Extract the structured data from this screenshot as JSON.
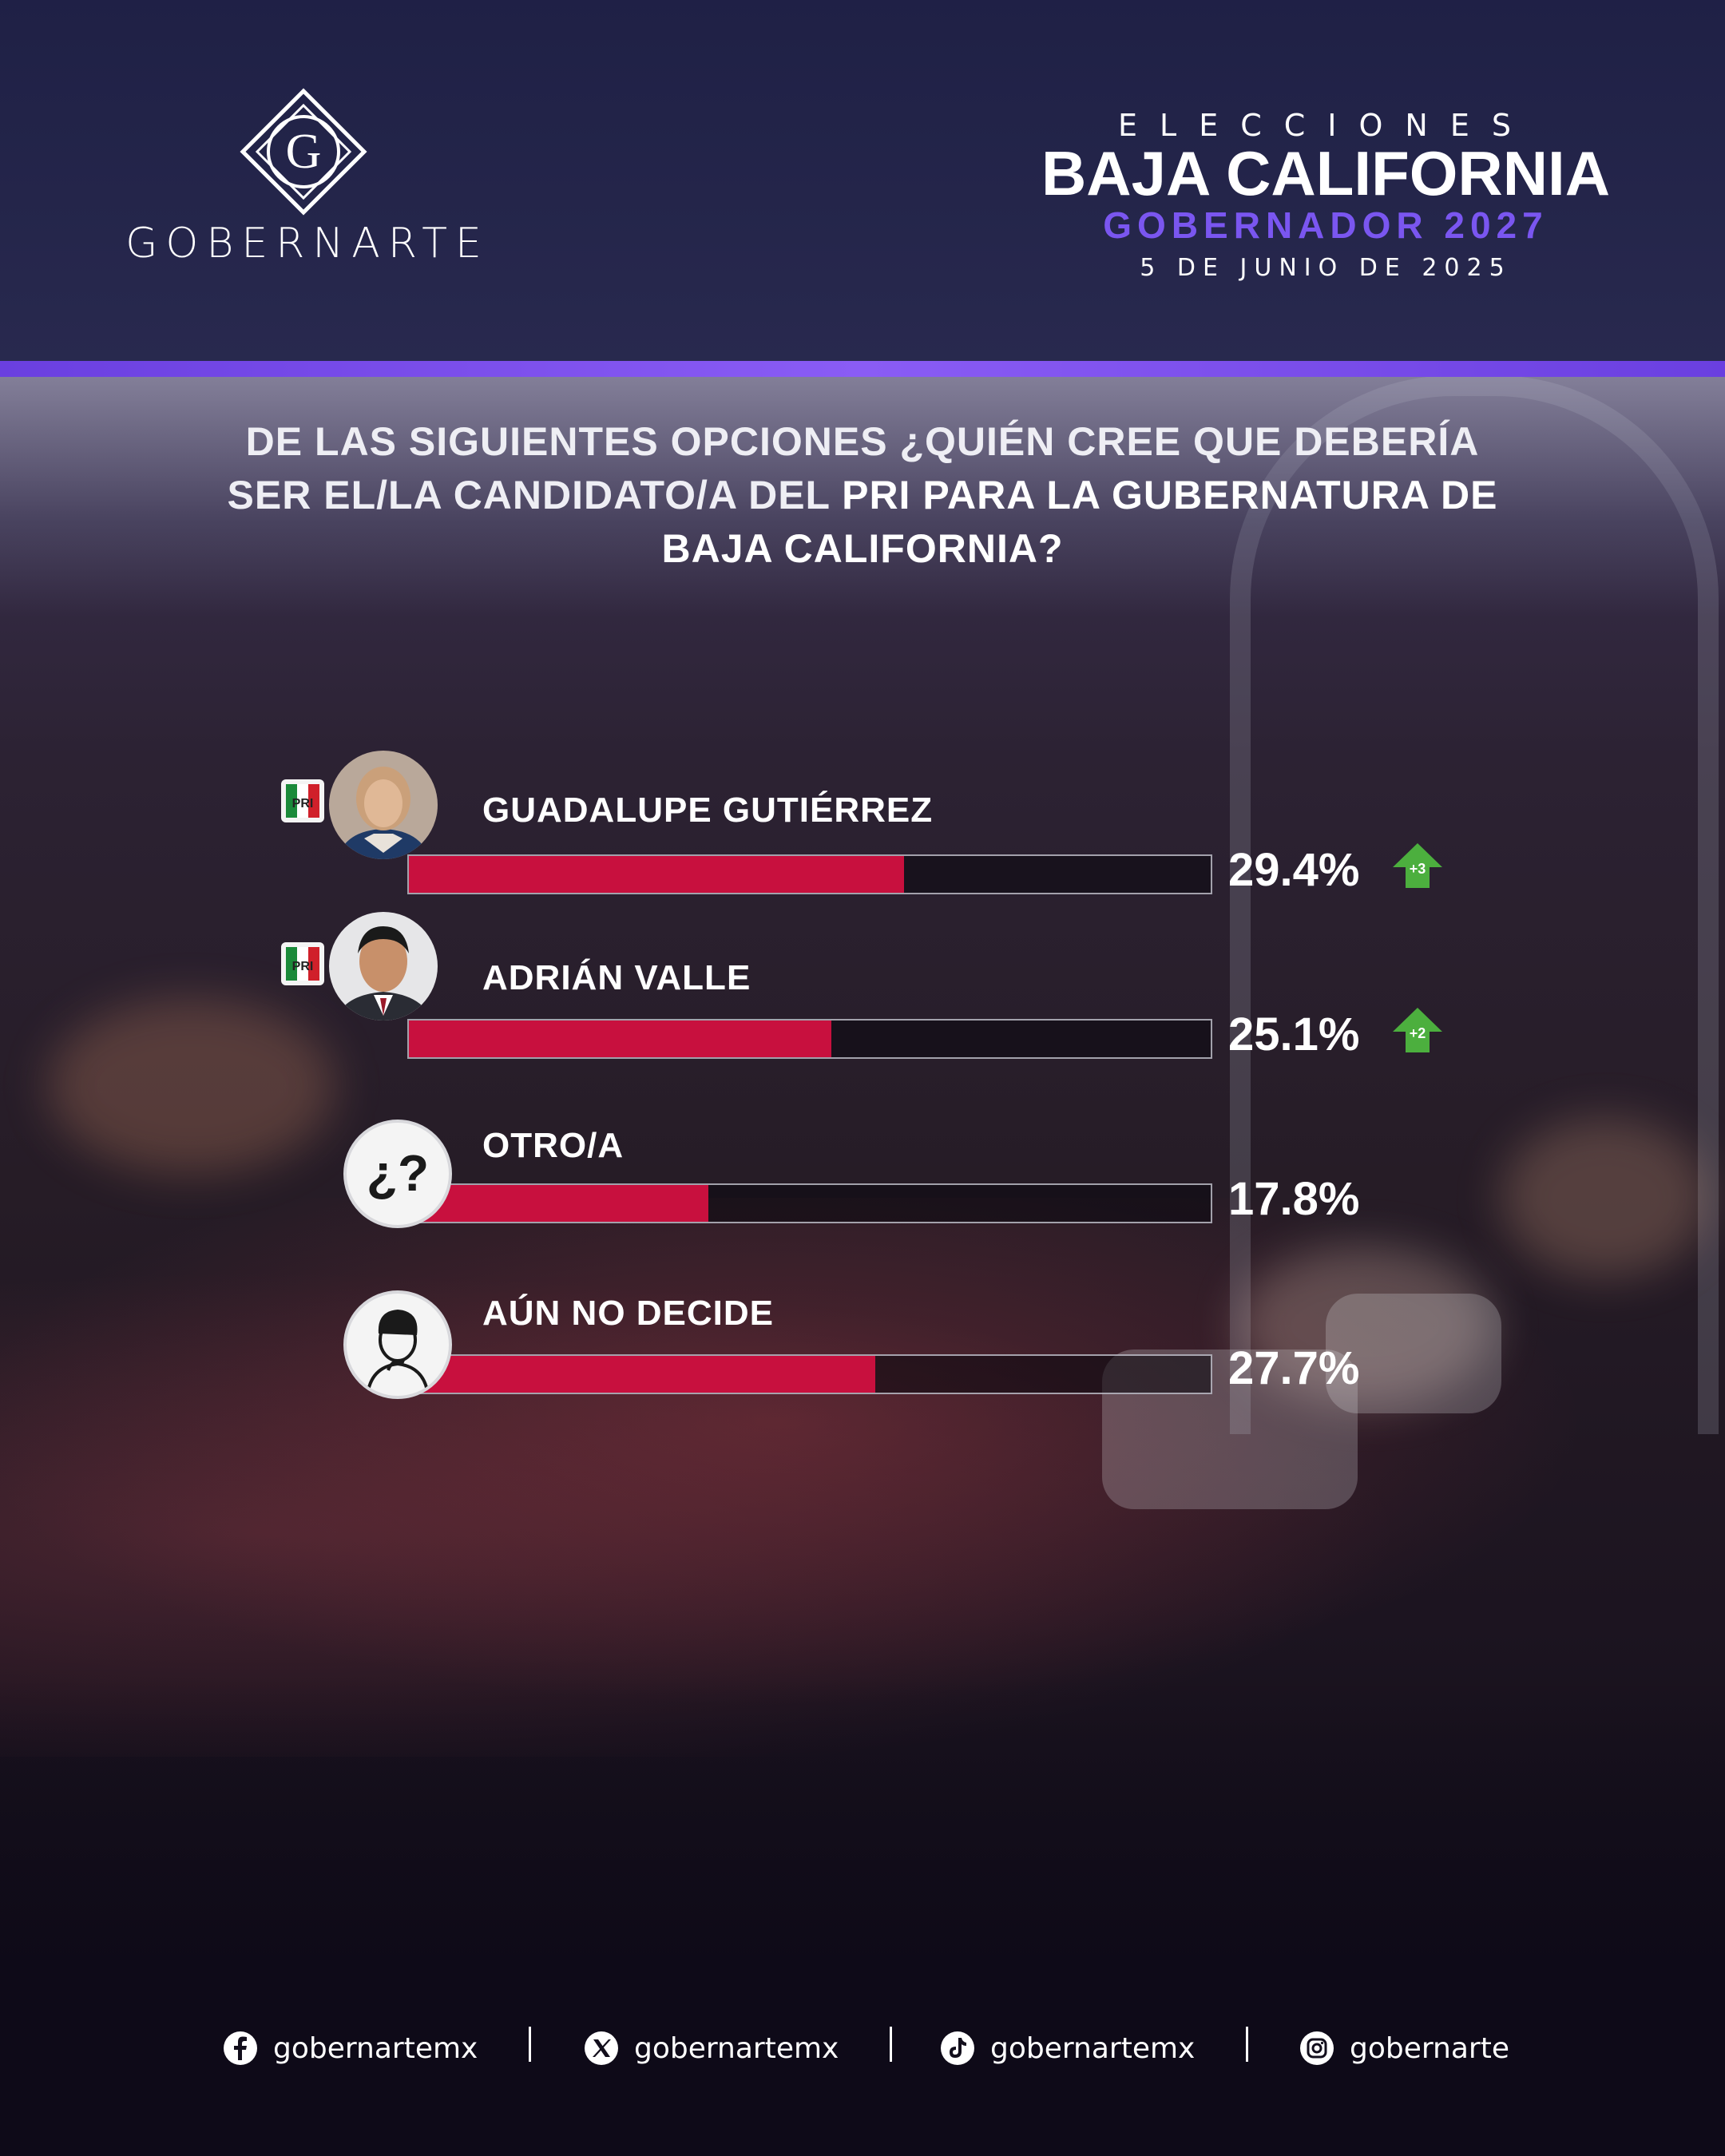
{
  "brand": {
    "logo_letter": "G",
    "name": "GOBERNARTE"
  },
  "header": {
    "elections": "ELECCIONES",
    "state": "BAJA CALIFORNIA",
    "race": "GOBERNADOR 2027",
    "date": "5 DE JUNIO DE 2025"
  },
  "question": {
    "normal": "DE LAS SIGUIENTES OPCIONES ¿QUIÉN CREE QUE DEBERÍA SER EL/LA CANDIDATO/A DEL ",
    "bold": "PRI PARA LA GUBERNATURA DE BAJA CALIFORNIA?"
  },
  "party_logo_text": "PRI",
  "chart_data": {
    "type": "bar",
    "orientation": "horizontal",
    "categories": [
      "GUADALUPE GUTIÉRREZ",
      "ADRIÁN VALLE",
      "OTRO/A",
      "AÚN NO DECIDE"
    ],
    "values": [
      29.4,
      25.1,
      17.8,
      27.7
    ],
    "value_labels": [
      "29.4%",
      "25.1%",
      "17.8%",
      "27.7%"
    ],
    "changes": [
      "+3",
      "+2",
      null,
      null
    ],
    "unit": "%",
    "xlim": [
      0,
      100
    ],
    "colors": {
      "bar": "#c8103e",
      "up_arrow": "#4caf3e",
      "accent": "#7a56f0"
    }
  },
  "icons": {
    "rows": [
      "candidate-photo",
      "candidate-photo",
      "question-mark-icon",
      "undecided-person-icon"
    ],
    "question_mark": "¿?"
  },
  "footer": {
    "socials": [
      {
        "icon": "facebook-icon",
        "handle": "gobernartemx"
      },
      {
        "icon": "x-icon",
        "handle": "gobernartemx"
      },
      {
        "icon": "tiktok-icon",
        "handle": "gobernartemx"
      },
      {
        "icon": "instagram-icon",
        "handle": "gobernarte"
      }
    ]
  }
}
